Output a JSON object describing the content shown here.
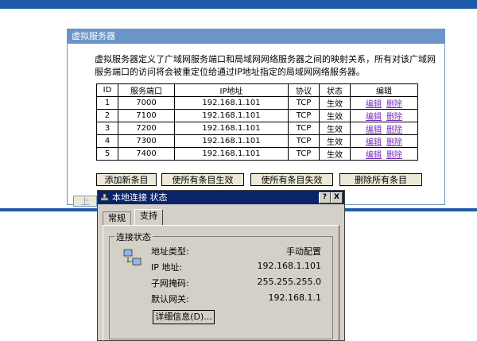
{
  "panel": {
    "title": "虚拟服务器",
    "description": "虚拟服务器定义了广域网服务端口和局域网网络服务器之间的映射关系，所有对该广域网服务端口的访问将会被重定位给通过IP地址指定的局域网网络服务器。"
  },
  "table": {
    "headers": [
      "ID",
      "服务端口",
      "IP地址",
      "协议",
      "状态",
      "编辑"
    ],
    "rows": [
      {
        "id": "1",
        "port": "7000",
        "ip": "192.168.1.101",
        "protocol": "TCP",
        "status": "生效"
      },
      {
        "id": "2",
        "port": "7100",
        "ip": "192.168.1.101",
        "protocol": "TCP",
        "status": "生效"
      },
      {
        "id": "3",
        "port": "7200",
        "ip": "192.168.1.101",
        "protocol": "TCP",
        "status": "生效"
      },
      {
        "id": "4",
        "port": "7300",
        "ip": "192.168.1.101",
        "protocol": "TCP",
        "status": "生效"
      },
      {
        "id": "5",
        "port": "7400",
        "ip": "192.168.1.101",
        "protocol": "TCP",
        "status": "生效"
      }
    ],
    "edit_label": "编辑",
    "delete_label": "删除"
  },
  "buttons": {
    "add": "添加新条目",
    "enable_all": "使所有条目生效",
    "disable_all": "使所有条目失效",
    "delete_all": "删除所有条目",
    "partial": "上"
  },
  "dialog": {
    "title": "本地连接 状态",
    "help": "?",
    "close": "X",
    "tabs": [
      "常规",
      "支持"
    ],
    "group_label": "连接状态",
    "rows": [
      {
        "label": "地址类型:",
        "value": "手动配置"
      },
      {
        "label": "IP 地址:",
        "value": "192.168.1.101"
      },
      {
        "label": "子网掩码:",
        "value": "255.255.255.0"
      },
      {
        "label": "默认网关:",
        "value": "192.168.1.1"
      }
    ],
    "details_button": "详细信息(D)...",
    "colors": {
      "titlebar": "#0a246a",
      "face": "#d4d0c8"
    },
    "icons": [
      "network-connection-icon",
      "network-computers-icon"
    ]
  },
  "colors": {
    "accent": "#1f5aa8",
    "panel_header": "#6b95c8",
    "link": "#7a2abd"
  }
}
